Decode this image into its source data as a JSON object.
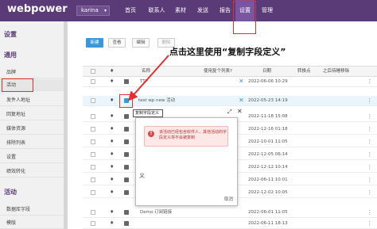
{
  "header": {
    "logo": "webpower",
    "user": "karina",
    "nav": [
      "首页",
      "联系人",
      "素材",
      "发送",
      "报告",
      "设置",
      "管理"
    ],
    "active_nav": "设置"
  },
  "sidebar": {
    "title": "设置",
    "section1": "通用",
    "items1": [
      "品牌",
      "活动",
      "发件人地址",
      "回复地址",
      "媒体资源",
      "排除列表",
      "设置",
      "绩效转化"
    ],
    "section2": "活动",
    "items2": [
      "数据库字段",
      "模版"
    ]
  },
  "toolbar": {
    "new": "新建",
    "view": "查看",
    "edit": "编辑",
    "delete": "删除"
  },
  "table": {
    "headers": {
      "name": "名称",
      "duplicate": "使用复个列表?",
      "date": "日期",
      "convert": "转换点",
      "last_modified": "之后待睡移除"
    },
    "rows": [
      {
        "name": "TTP",
        "date": "2022-06-06 10:29"
      },
      {
        "name": "test wp new 活动",
        "date": "2022-05-23 14:19"
      },
      {
        "name": "",
        "date": "2022-11-18 15:08"
      },
      {
        "name": "",
        "date": "2022-12-16 01:18"
      },
      {
        "name": "",
        "date": "2022-10-01 11:05"
      },
      {
        "name": "",
        "date": "2022-12-05 06:14"
      },
      {
        "name": "",
        "date": "2022-12-12 10:14"
      },
      {
        "name": "",
        "date": "2022-06-11 10:01"
      },
      {
        "name": "",
        "date": "2022-12-02 10:05"
      },
      {
        "name": "义",
        "date": "2022-05-14 14:09"
      },
      {
        "name": "",
        "date": "2022-02-30 13:38"
      },
      {
        "name": "",
        "date": "2022-03-12 11:26"
      },
      {
        "name": "Demo 订阅链接",
        "date": "2022-06-01 11:05"
      },
      {
        "name": "",
        "date": "2022-06-11 18:13"
      }
    ]
  },
  "tooltip": "复制字段定义",
  "modal": {
    "alert": "该活动已经包含收件人，其他活动的字段定义将不会被复制",
    "cancel": "取消"
  },
  "annotation": {
    "text": "点击这里使用“复制字段定义”",
    "color": "#e03030"
  },
  "colors": {
    "brand": "#5b3a78",
    "primary": "#3c97d8"
  }
}
